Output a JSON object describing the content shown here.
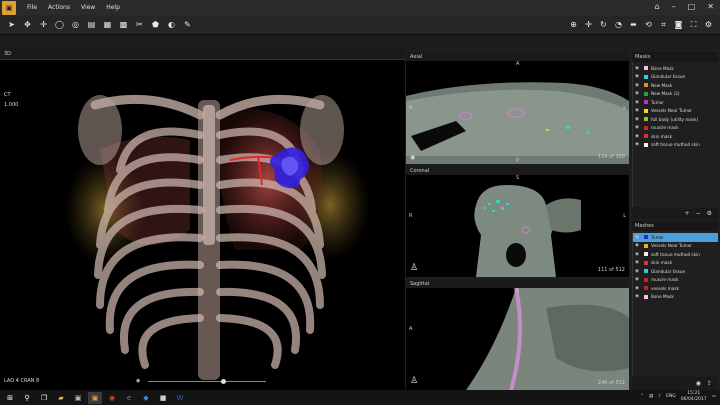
{
  "menu": {
    "items": [
      "File",
      "Actions",
      "View",
      "Help"
    ]
  },
  "panels": {
    "left_title": "3D",
    "axial_title": "Axial",
    "coronal_title": "Coronal",
    "sagittal_title": "Sagittal",
    "masks_title": "Masks",
    "meshes_title": "Meshes"
  },
  "view3d": {
    "modality": "CT",
    "opacity": "1.000",
    "orientation": "LAO 4   CRAN 8"
  },
  "axial": {
    "top": "A",
    "left": "R",
    "right": "L",
    "bottom": "P",
    "count": "124 of 320"
  },
  "coronal": {
    "top": "S",
    "left": "R",
    "right": "L",
    "count": "111 of 512"
  },
  "sagittal": {
    "left": "A",
    "top": "S",
    "count": "246 of 512"
  },
  "masks": [
    {
      "label": "Bone Mask",
      "color": "#f2c4e8"
    },
    {
      "label": "Glandular tissue",
      "color": "#33ccdd"
    },
    {
      "label": "New Mask",
      "color": "#e88a2a"
    },
    {
      "label": "New Mask (2)",
      "color": "#2e9e3a"
    },
    {
      "label": "Tumor",
      "color": "#c030c0"
    },
    {
      "label": "Vessels Near Tumor",
      "color": "#e8e020"
    },
    {
      "label": "full body (utility mask)",
      "color": "#9ac040"
    },
    {
      "label": "muscle mask",
      "color": "#d02020"
    },
    {
      "label": "skin mask",
      "color": "#e03030"
    },
    {
      "label": "soft tissue muthod skin",
      "color": "#f0f0f0"
    }
  ],
  "meshes": [
    {
      "label": "Tumor",
      "color": "#2030d0",
      "selected": true
    },
    {
      "label": "Vessels Near Tumor",
      "color": "#e8b020",
      "selected": false
    },
    {
      "label": "soft tissue muthod skin",
      "color": "#f0f0f0",
      "selected": false
    },
    {
      "label": "skin mask",
      "color": "#e03030",
      "selected": false
    },
    {
      "label": "Glandular tissue",
      "color": "#33ccdd",
      "selected": false
    },
    {
      "label": "muscle mask",
      "color": "#d02020",
      "selected": false
    },
    {
      "label": "vessels mask",
      "color": "#c02020",
      "selected": false
    },
    {
      "label": "Bone Mask",
      "color": "#f2c4e8",
      "selected": false
    }
  ],
  "taskbar": {
    "lang": "ENG",
    "time": "15:21",
    "date": "06/04/2017"
  },
  "colors": {
    "accent": "#4aa0de",
    "logo": "#e0a030"
  }
}
